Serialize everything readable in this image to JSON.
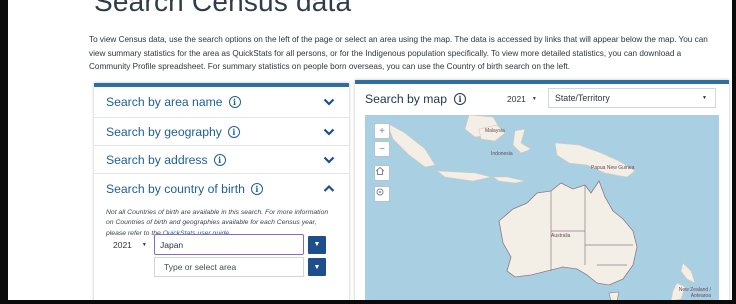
{
  "page": {
    "title": "Search Census data",
    "intro": "To view Census data, use the search options on the left of the page or select an area using the map. The data is accessed by links that will appear below the map. You can view summary statistics for the area as QuickStats for all persons, or for the Indigenous population specifically. To view more detailed statistics, you can download a Community Profile spreadsheet. For summary statistics on people born overseas, you can use the Country of birth search on the left."
  },
  "search": {
    "sections": [
      {
        "label": "Search by area name",
        "icon": "info-icon",
        "state": "collapsed"
      },
      {
        "label": "Search by geography",
        "icon": "info-icon",
        "state": "collapsed"
      },
      {
        "label": "Search by address",
        "icon": "info-icon",
        "state": "collapsed"
      },
      {
        "label": "Search by country of birth",
        "icon": "info-icon",
        "state": "expanded"
      }
    ],
    "country_note_pre": "Not all Countries of birth are available in this search. For more information on Countries of birth and geographies available for each Census year, please refer to the ",
    "country_note_link": "QuickStats user guide",
    "country_note_post": ".",
    "year": "2021",
    "country_value": "Japan",
    "area_placeholder": "Type or select area"
  },
  "map": {
    "title": "Search by map",
    "year": "2021",
    "level": "State/Territory",
    "zoom_in": "+",
    "zoom_out": "−",
    "labels": {
      "malaysia": "Malaysia",
      "indonesia": "Indonesia",
      "png": "Papua New Guinea",
      "australia": "Australia",
      "nz": "New Zealand / Aotearoa"
    }
  },
  "colors": {
    "accent": "#1f5f95",
    "panel_border": "#2f6f9f",
    "button": "#1f4f8a",
    "focus": "#8a6bb8",
    "water": "#a9cfe2",
    "land": "#f3efe6"
  }
}
